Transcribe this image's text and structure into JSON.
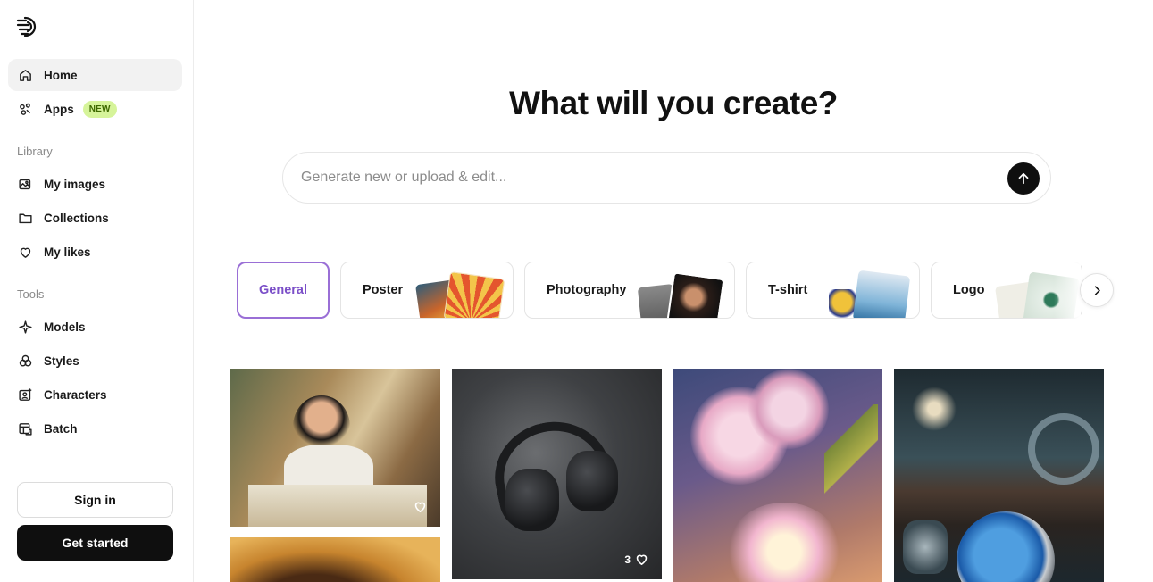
{
  "sidebar": {
    "home": "Home",
    "apps": "Apps",
    "apps_badge": "NEW",
    "library_label": "Library",
    "my_images": "My images",
    "collections": "Collections",
    "my_likes": "My likes",
    "tools_label": "Tools",
    "models": "Models",
    "styles": "Styles",
    "characters": "Characters",
    "batch": "Batch",
    "sign_in": "Sign in",
    "get_started": "Get started"
  },
  "main": {
    "headline": "What will you create?",
    "search_placeholder": "Generate new or upload & edit...",
    "categories": [
      "General",
      "Poster",
      "Photography",
      "T-shirt",
      "Logo"
    ]
  },
  "gallery": {
    "card2_likes": "3"
  },
  "colors": {
    "accent": "#7b4fc8",
    "badge_bg": "#d6f49a",
    "primary": "#0f0f0f"
  }
}
